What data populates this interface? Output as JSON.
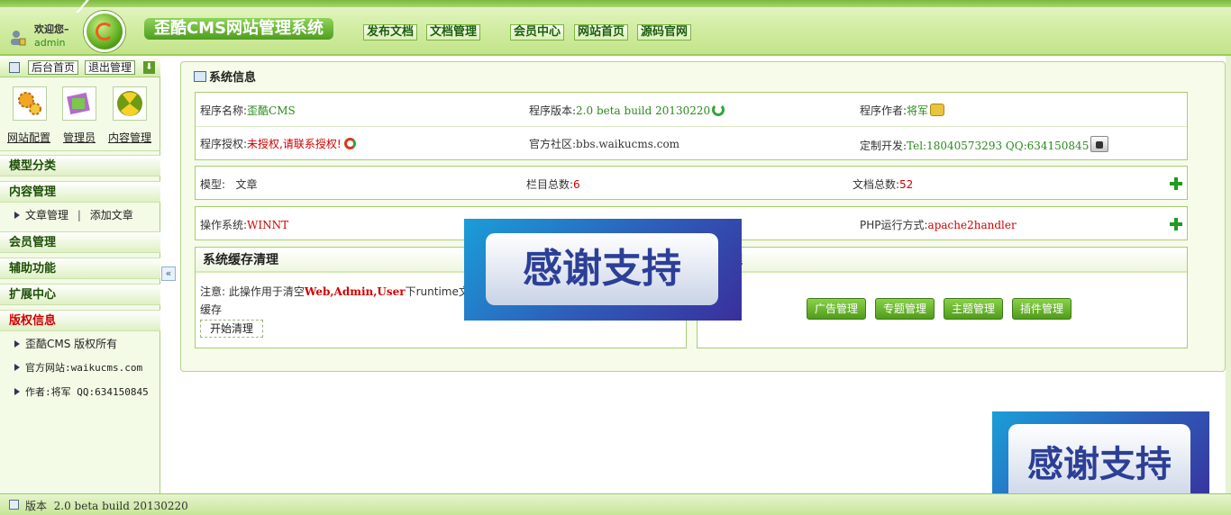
{
  "header": {
    "welcome": "欢迎您–",
    "user": "admin",
    "site_title": "歪酷CMS网站管理系统",
    "links": [
      "发布文档",
      "文档管理",
      "会员中心",
      "网站首页",
      "源码官网"
    ]
  },
  "sidebar": {
    "top_buttons": [
      "后台首页",
      "退出管理"
    ],
    "quick_icons": [
      {
        "label": "网站配置",
        "icon": "gears-icon"
      },
      {
        "label": "管理员",
        "icon": "admin-book-icon"
      },
      {
        "label": "内容管理",
        "icon": "content-globe-icon"
      }
    ],
    "sections": {
      "model": "模型分类",
      "content": "内容管理",
      "content_items": {
        "article_manage": "文章管理",
        "divider": "|",
        "article_add": "添加文章"
      },
      "member": "会员管理",
      "aux": "辅助功能",
      "ext": "扩展中心",
      "copyright": "版权信息",
      "copyright_items": [
        "歪酷CMS 版权所有",
        "官方网站:waikucms.com",
        "作者:将军 QQ:634150845"
      ]
    },
    "collapse": "«"
  },
  "main": {
    "title": "系统信息",
    "info": {
      "name_label": "程序名称:",
      "name_value": "歪酷CMS",
      "version_label": "程序版本:",
      "version_value": "2.0 beta build 20130220",
      "author_label": "程序作者:",
      "author_value": "将军",
      "license_label": "程序授权:",
      "license_value": "未授权,请联系授权!",
      "community_label": "官方社区:",
      "community_value": "bbs.waikucms.com",
      "custom_label": "定制开发:",
      "custom_value": "Tel:18040573293 QQ:634150845"
    },
    "stats": {
      "model_label": "模型:",
      "model_value": "文章",
      "column_label": "栏目总数:",
      "column_value": "6",
      "doc_label": "文档总数:",
      "doc_value": "52"
    },
    "env": {
      "os_label": "操作系统:",
      "os_value": "WINNT",
      "php_label": "PHP运行方式:",
      "php_value": "apache2handler"
    },
    "cache": {
      "title": "系统缓存清理",
      "note_prefix": "注意: 此操作用于清空",
      "note_highlight": "Web,Admin,User",
      "note_suffix": "下runtime文件夹",
      "note_line2": "缓存",
      "button": "开始清理"
    },
    "manage": {
      "title_visible": "理",
      "buttons": [
        "广告管理",
        "专题管理",
        "主题管理",
        "插件管理"
      ]
    }
  },
  "watermark": {
    "text": "感谢支持"
  },
  "footer": {
    "version_label": "版本",
    "version_value": "2.0 beta build 20130220"
  },
  "colors": {
    "accent_green": "#2a8a1c",
    "red": "#d10000",
    "header_green": "#9acc57"
  }
}
